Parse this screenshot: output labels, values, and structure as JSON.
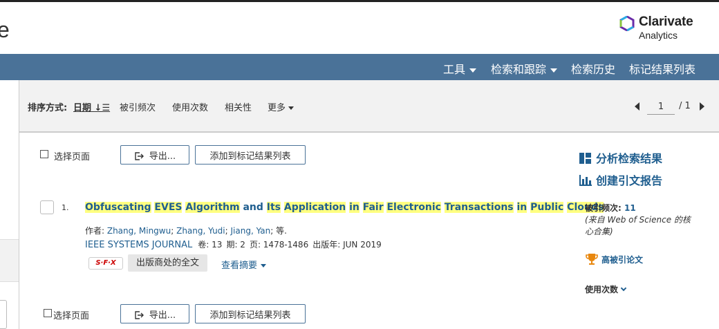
{
  "header": {
    "app_fragment": "e",
    "logo": {
      "brand": "Clarivate",
      "sub": "Analytics"
    }
  },
  "nav": {
    "tools": "工具",
    "search_track": "检索和跟踪",
    "history": "检索历史",
    "marked_list": "标记结果列表"
  },
  "sort": {
    "label": "排序方式:",
    "date": "日期",
    "date_icon": "↓☰",
    "times_cited": "被引频次",
    "usage_count": "使用次数",
    "relevance": "相关性",
    "more": "更多"
  },
  "pager": {
    "current": "1",
    "total": "/ 1"
  },
  "selection_top": {
    "select_page": "选择页面",
    "export": "导出...",
    "add_to_marked": "添加到标记结果列表"
  },
  "selection_bottom": {
    "select_page": "选择页面",
    "export": "导出...",
    "add_to_marked": "添加到标记结果列表"
  },
  "sidebar": {
    "analyze": "分析检索结果",
    "citation_report": "创建引文报告"
  },
  "result": {
    "number": "1.",
    "title_words": [
      {
        "t": "Obfuscating",
        "hl": true
      },
      {
        "t": " ",
        "hl": false
      },
      {
        "t": "EVES",
        "hl": true
      },
      {
        "t": " ",
        "hl": false
      },
      {
        "t": "Algorithm",
        "hl": true
      },
      {
        "t": " and ",
        "hl": false
      },
      {
        "t": "Its",
        "hl": true
      },
      {
        "t": " ",
        "hl": false
      },
      {
        "t": "Application",
        "hl": true
      },
      {
        "t": " ",
        "hl": false
      },
      {
        "t": "in",
        "hl": true
      },
      {
        "t": " ",
        "hl": false
      },
      {
        "t": "Fair",
        "hl": true
      },
      {
        "t": " ",
        "hl": false
      },
      {
        "t": "Electronic",
        "hl": true
      },
      {
        "t": " ",
        "hl": false
      },
      {
        "t": "Transactions",
        "hl": true
      },
      {
        "t": " ",
        "hl": false
      },
      {
        "t": "in",
        "hl": true
      },
      {
        "t": " ",
        "hl": false
      },
      {
        "t": "Public",
        "hl": true
      },
      {
        "t": " ",
        "hl": false
      },
      {
        "t": "Clouds",
        "hl": true
      }
    ],
    "authors_label": "作者: ",
    "authors": [
      "Zhang, Mingwu",
      "Zhang, Yudi",
      "Jiang, Yan"
    ],
    "authors_sep": "; ",
    "authors_tail": "; 等.",
    "journal": "IEEE SYSTEMS JOURNAL",
    "volume": "卷: 13",
    "issue": "期: 2",
    "pages": "页: 1478-1486",
    "pub_year": "出版年: JUN 2019",
    "sfx": "S·F·X",
    "full_text": "出版商处的全文",
    "view_abstract": "查看摘要",
    "times_cited_label": "被引频次: ",
    "times_cited": "11",
    "times_cited_note": "(来自 Web of Science 的核心合集)",
    "highly_cited": "高被引论文",
    "usage_count": "使用次数"
  },
  "colors": {
    "navbar": "#4a7298",
    "link": "#1f5e8f",
    "highlight": "#ffff80",
    "trophy": "#e8870e"
  }
}
